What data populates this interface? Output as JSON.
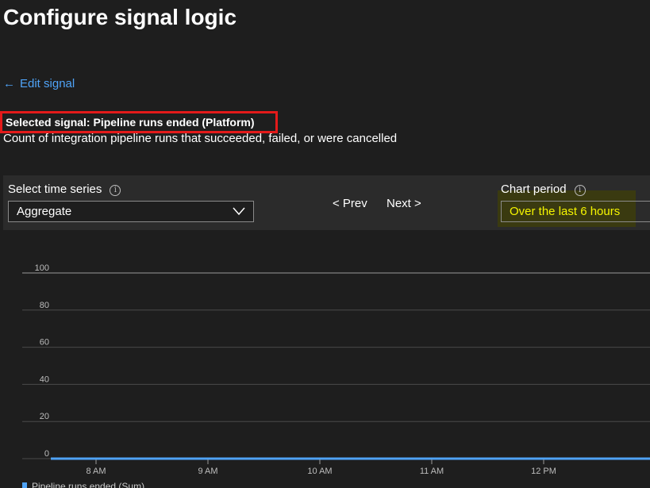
{
  "page": {
    "title": "Configure signal logic",
    "edit_signal_arrow": "←",
    "edit_signal_label": "Edit signal",
    "selected_signal": "Selected signal: Pipeline runs ended (Platform)",
    "description": "Count of integration pipeline runs that succeeded, failed, or were cancelled"
  },
  "toolbar": {
    "time_series_label": "Select time series",
    "time_series_value": "Aggregate",
    "info_glyph": "i",
    "prev_label": "< Prev",
    "next_label": "Next >",
    "chart_period_label": "Chart period",
    "chart_period_value": "Over the last 6 hours"
  },
  "chart_data": {
    "type": "line",
    "y_ticks": [
      "100",
      "80",
      "60",
      "40",
      "20",
      "0"
    ],
    "ylim": [
      0,
      100
    ],
    "x_ticks": [
      "8 AM",
      "9 AM",
      "10 AM",
      "11 AM",
      "12 PM"
    ],
    "series": [
      {
        "name": "Pipeline runs ended (Sum)",
        "values": [
          0,
          0,
          0,
          0,
          0,
          0
        ]
      }
    ],
    "grid": true
  },
  "colors": {
    "accent": "#4fa3f7",
    "highlight_border": "#e31a1a",
    "period_text": "#f5f500",
    "background": "#1e1e1e",
    "toolbar": "#2b2b2b"
  }
}
